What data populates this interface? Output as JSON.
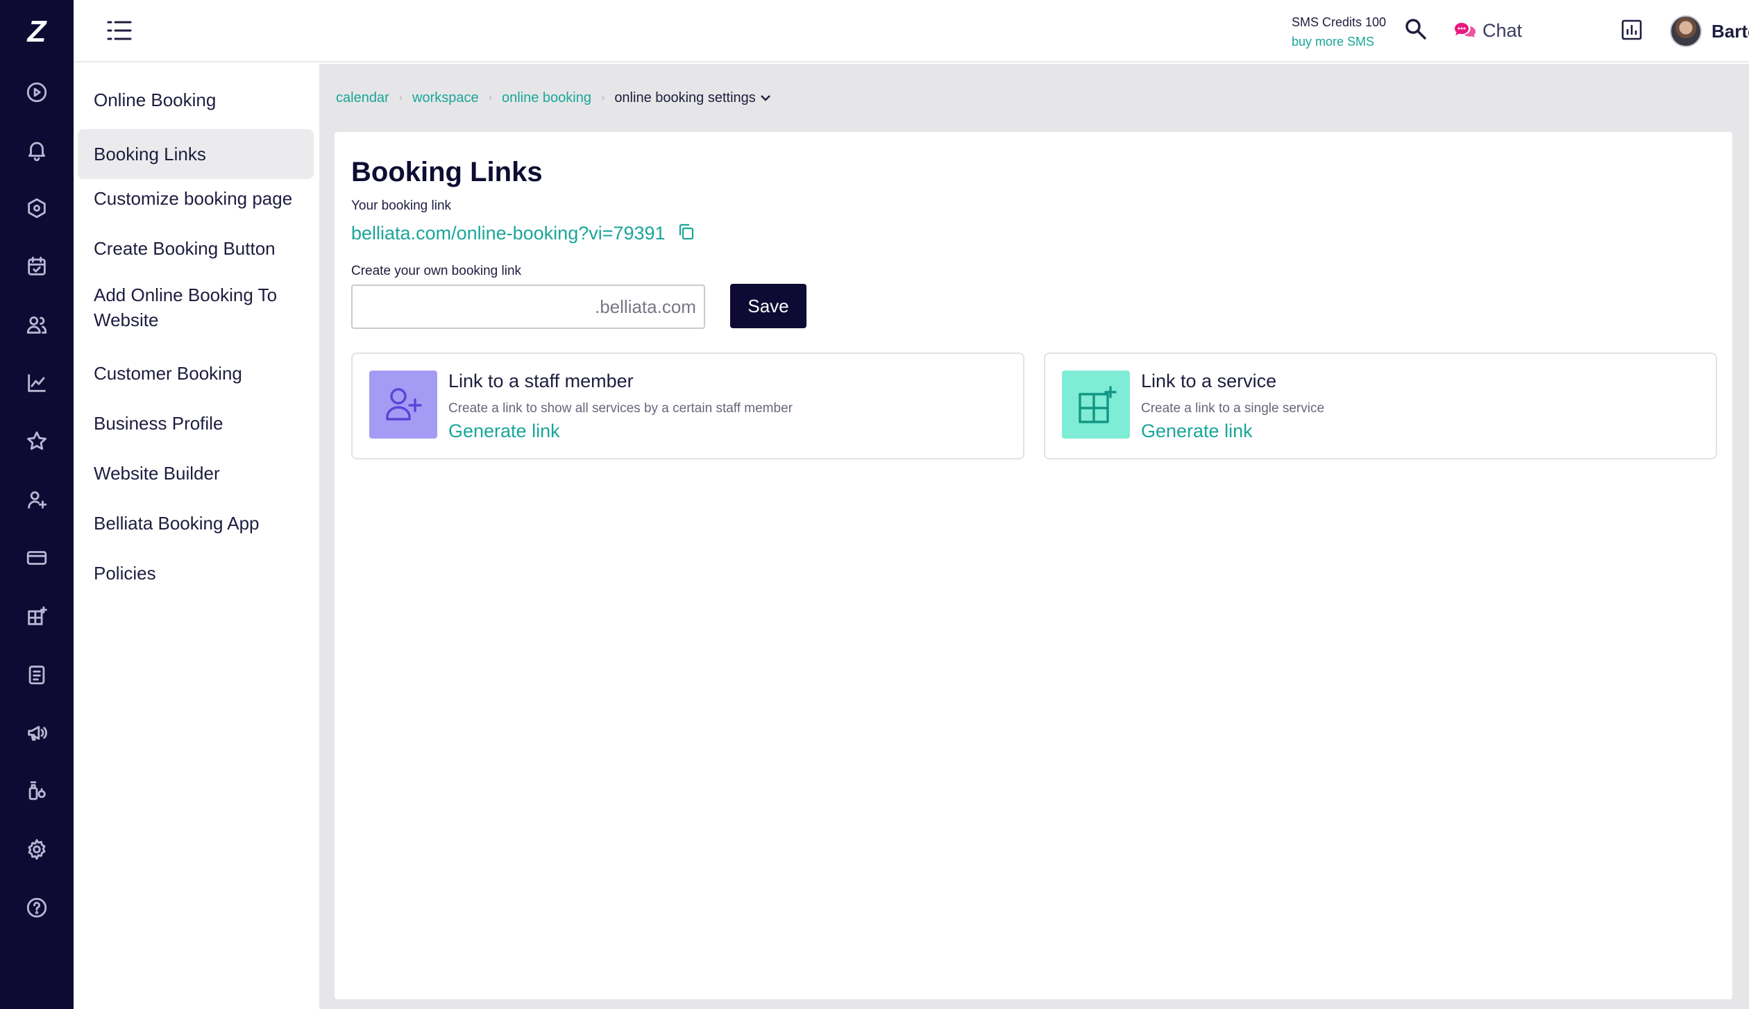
{
  "app": {
    "logo": "Z",
    "accent": "#1aa69a",
    "rail_bg": "#0d0b33"
  },
  "rail": {
    "items": [
      "play-icon",
      "bell-icon",
      "hexagon-icon",
      "calendar-check-icon",
      "clients-icon",
      "chart-icon",
      "star-icon",
      "staff-icon",
      "card-icon",
      "add-grid-icon",
      "clipboard-icon",
      "megaphone-icon",
      "products-icon",
      "gear-icon",
      "help-icon"
    ]
  },
  "header": {
    "sms_credits": "SMS Credits 100",
    "buy_sms": "buy more SMS",
    "chat": "Chat",
    "user_name": "Bartek"
  },
  "subnav": {
    "items": [
      {
        "label": "Online Booking"
      },
      {
        "label": "Booking Links",
        "active": true
      },
      {
        "label": "Customize booking page"
      },
      {
        "label": "Create Booking Button"
      },
      {
        "label": "Add Online Booking To Website"
      },
      {
        "label": "Customer Booking"
      },
      {
        "label": "Business Profile"
      },
      {
        "label": "Website Builder"
      },
      {
        "label": "Belliata Booking App"
      },
      {
        "label": "Policies"
      }
    ]
  },
  "breadcrumb": {
    "items": [
      "calendar",
      "workspace",
      "online booking"
    ],
    "current": "online booking settings"
  },
  "content": {
    "title": "Booking Links",
    "your_link_label": "Your booking link",
    "your_link": "belliata.com/online-booking?vi=79391",
    "own_link_label": "Create your own booking link",
    "own_link_value": "",
    "own_link_suffix": ".belliata.com",
    "save": "Save",
    "cards": [
      {
        "title": "Link to a staff member",
        "description": "Create a link to show all services by a certain staff member",
        "action": "Generate link",
        "icon": "add-person-icon",
        "icon_bg": "#a49bf4",
        "icon_color": "#6b54e0"
      },
      {
        "title": "Link to a service",
        "description": "Create a link to a single service",
        "action": "Generate link",
        "icon": "add-grid-icon",
        "icon_bg": "#7fecd6",
        "icon_color": "#159e8c"
      }
    ]
  }
}
